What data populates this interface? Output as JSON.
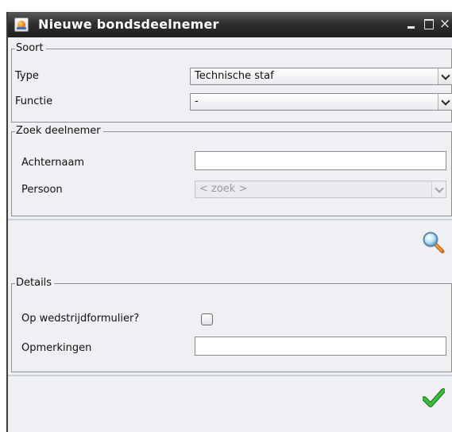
{
  "window": {
    "title": "Nieuwe bondsdeelnemer",
    "icon": "java-cup-icon",
    "controls": {
      "minimize": "minimize-icon",
      "maximize": "maximize-icon",
      "close": "×"
    }
  },
  "soort": {
    "legend": "Soort",
    "type_label": "Type",
    "type_value": "Technische staf",
    "functie_label": "Functie",
    "functie_value": "-"
  },
  "zoek": {
    "legend": "Zoek deelnemer",
    "achternaam_label": "Achternaam",
    "achternaam_value": "",
    "persoon_label": "Persoon",
    "persoon_value": "< zoek >"
  },
  "search_button": {
    "icon": "magnifier-icon"
  },
  "details": {
    "legend": "Details",
    "wedstrijd_label": "Op wedstrijdformulier?",
    "wedstrijd_checked": false,
    "opmerkingen_label": "Opmerkingen",
    "opmerkingen_value": ""
  },
  "ok_button": {
    "icon": "green-checkmark-icon",
    "color": "#2f9e2f"
  }
}
